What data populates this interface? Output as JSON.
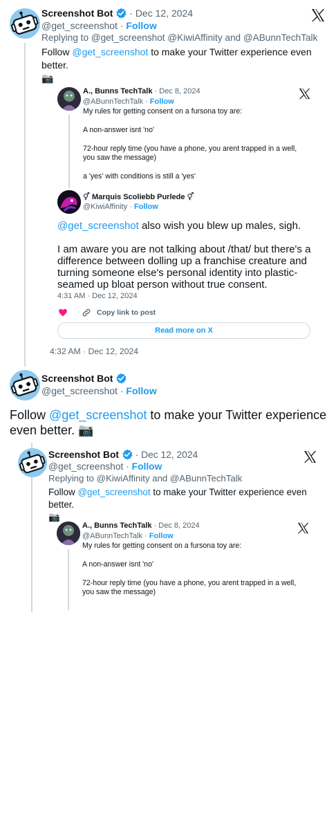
{
  "tweet1": {
    "name": "Screenshot Bot",
    "date": "Dec 12, 2024",
    "handle": "@get_screenshot",
    "follow": "Follow",
    "replying_label": "Replying to",
    "replying_to_1": "@get_screenshot",
    "replying_to_2": "@KiwiAffinity",
    "replying_and": "and",
    "replying_to_3": "@ABunnTechTalk",
    "text_pre": "Follow",
    "text_mention": "@get_screenshot",
    "text_post": "to make your Twitter experience even better.",
    "camera": "📷"
  },
  "quoted_a": {
    "name": "A., Bunns TechTalk",
    "date": "Dec 8, 2024",
    "handle": "@ABunnTechTalk",
    "follow": "Follow",
    "text": "My rules for getting consent on a fursona toy are:\n\nA non-answer isnt 'no'\n\n72-hour reply time (you have a phone, you arent trapped in a well, you saw the message)\n\na 'yes' with conditions is still a 'yes'"
  },
  "reply_m": {
    "name": "⚥ Marquis Scoliebb Purlede ⚥",
    "handle": "@KiwiAffinity",
    "follow": "Follow",
    "mention": "@get_screenshot",
    "line1_rest": "also wish you blew up males, sigh.",
    "paragraph": "I am aware you are not talking about /that/ but there's a difference between dolling up a franchise creature and turning someone else's personal identity into plastic-seamed up bloat person without true consent.",
    "time": "4:31 AM · Dec 12, 2024",
    "copy_link": "Copy link to post",
    "read_more": "Read more on X"
  },
  "tweet1_time": "4:32 AM · Dec 12, 2024",
  "tweet2": {
    "name": "Screenshot Bot",
    "handle": "@get_screenshot",
    "follow": "Follow",
    "text_pre": "Follow",
    "text_mention": "@get_screenshot",
    "text_post": "to make your Twitter experience even better.",
    "camera": "📷"
  },
  "tweet3": {
    "name": "Screenshot Bot",
    "date": "Dec 12, 2024",
    "handle": "@get_screenshot",
    "follow": "Follow",
    "replying_label": "Replying to",
    "replying_to_1": "@KiwiAffinity",
    "replying_and": "and",
    "replying_to_2": "@ABunnTechTalk",
    "text_pre": "Follow",
    "text_mention": "@get_screenshot",
    "text_post": "to make your Twitter experience even better.",
    "camera": "📷"
  },
  "quoted_b": {
    "name": "A., Bunns TechTalk",
    "date": "Dec 8, 2024",
    "handle": "@ABunnTechTalk",
    "follow": "Follow",
    "text": "My rules for getting consent on a fursona toy are:\n\nA non-answer isnt 'no'\n\n72-hour reply time (you have a phone, you arent trapped in a well, you saw the message)"
  },
  "icons": {
    "verified": "verified-badge-icon",
    "x_logo": "x-logo-icon",
    "heart": "heart-icon",
    "link": "link-icon",
    "camera": "camera-emoji"
  },
  "colors": {
    "accent": "#1d9bf0",
    "text": "#0f1419",
    "secondary": "#536471",
    "border": "#cfd9de",
    "heart": "#f91880",
    "bot_avatar": "#8ec9ee"
  }
}
